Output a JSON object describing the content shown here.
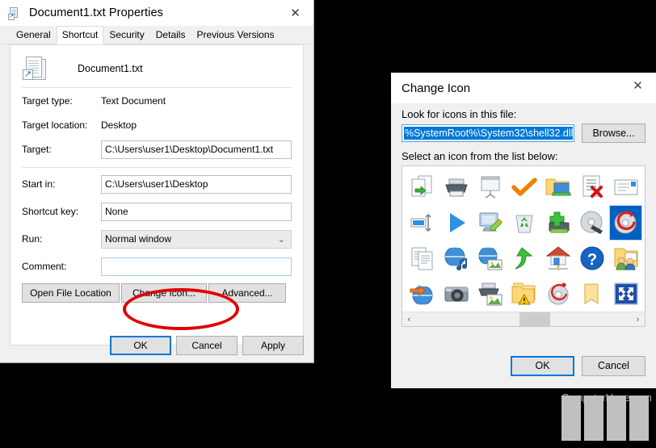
{
  "properties_dialog": {
    "title": "Document1.txt Properties",
    "close_label": "✕",
    "tabs": [
      {
        "label": "General",
        "active": false
      },
      {
        "label": "Shortcut",
        "active": true
      },
      {
        "label": "Security",
        "active": false
      },
      {
        "label": "Details",
        "active": false
      },
      {
        "label": "Previous Versions",
        "active": false
      }
    ],
    "file_name": "Document1.txt",
    "fields": {
      "target_type_label": "Target type:",
      "target_type_value": "Text Document",
      "target_location_label": "Target location:",
      "target_location_value": "Desktop",
      "target_label": "Target:",
      "target_value": "C:\\Users\\user1\\Desktop\\Document1.txt",
      "start_in_label": "Start in:",
      "start_in_value": "C:\\Users\\user1\\Desktop",
      "shortcut_key_label": "Shortcut key:",
      "shortcut_key_value": "None",
      "run_label": "Run:",
      "run_value": "Normal window",
      "run_chevron": "⌄",
      "comment_label": "Comment:",
      "comment_value": ""
    },
    "action_buttons": {
      "open_file_location": "Open File Location",
      "change_icon": "Change Icon...",
      "advanced": "Advanced..."
    },
    "footer_buttons": {
      "ok": "OK",
      "cancel": "Cancel",
      "apply": "Apply"
    }
  },
  "change_icon_dialog": {
    "title": "Change Icon",
    "close_label": "✕",
    "file_label": "Look for icons in this file:",
    "file_value": "%SystemRoot%\\System32\\shell32.dll",
    "browse_label": "Browse...",
    "list_label": "Select an icon from the list below:",
    "icons": [
      {
        "name": "copy-file-to-icon",
        "selected": false
      },
      {
        "name": "printer-icon",
        "selected": false
      },
      {
        "name": "projector-screen-icon",
        "selected": false
      },
      {
        "name": "orange-checkmark-icon",
        "selected": false
      },
      {
        "name": "folder-network-share-icon",
        "selected": false
      },
      {
        "name": "document-delete-icon",
        "selected": false
      },
      {
        "name": "envelope-mail-icon",
        "selected": false
      },
      {
        "name": "users-group-icon",
        "selected": false
      },
      {
        "name": "resize-width-icon",
        "selected": false
      },
      {
        "name": "blue-play-triangle-icon",
        "selected": false
      },
      {
        "name": "display-settings-pencil-icon",
        "selected": false
      },
      {
        "name": "recycle-bin-icon",
        "selected": false
      },
      {
        "name": "add-drive-green-plus-icon",
        "selected": false
      },
      {
        "name": "disc-with-usb-icon",
        "selected": false
      },
      {
        "name": "burn-disc-red-icon",
        "selected": true
      },
      {
        "name": "computer-display-icon",
        "selected": false
      },
      {
        "name": "documents-stack-icon",
        "selected": false
      },
      {
        "name": "globe-music-icon",
        "selected": false
      },
      {
        "name": "globe-picture-icon",
        "selected": false
      },
      {
        "name": "green-up-arrow-icon",
        "selected": false
      },
      {
        "name": "home-network-icon",
        "selected": false
      },
      {
        "name": "blue-question-help-icon",
        "selected": false
      },
      {
        "name": "shared-folder-users-icon",
        "selected": false
      },
      {
        "name": "disc-drive-icon",
        "selected": false
      },
      {
        "name": "globe-orange-arrow-icon",
        "selected": false
      },
      {
        "name": "camera-icon",
        "selected": false
      },
      {
        "name": "printer-photo-icon",
        "selected": false
      },
      {
        "name": "folder-warning-icon",
        "selected": false
      },
      {
        "name": "disc-record-icon",
        "selected": false
      },
      {
        "name": "plain-folder-icon",
        "selected": false
      },
      {
        "name": "fullscreen-arrows-icon",
        "selected": false
      },
      {
        "name": "printer-scanner-icon",
        "selected": false
      }
    ],
    "scrollbar": {
      "left_arrow": "‹",
      "right_arrow": "›"
    },
    "footer_buttons": {
      "ok": "OK",
      "cancel": "Cancel"
    }
  },
  "watermark": {
    "text": "ComputerHope.com"
  },
  "colors": {
    "accent": "#0078d7",
    "selection": "#0060c0",
    "annotation": "#e00000",
    "window_bg": "#f0f0f0",
    "backdrop": "#000000"
  }
}
